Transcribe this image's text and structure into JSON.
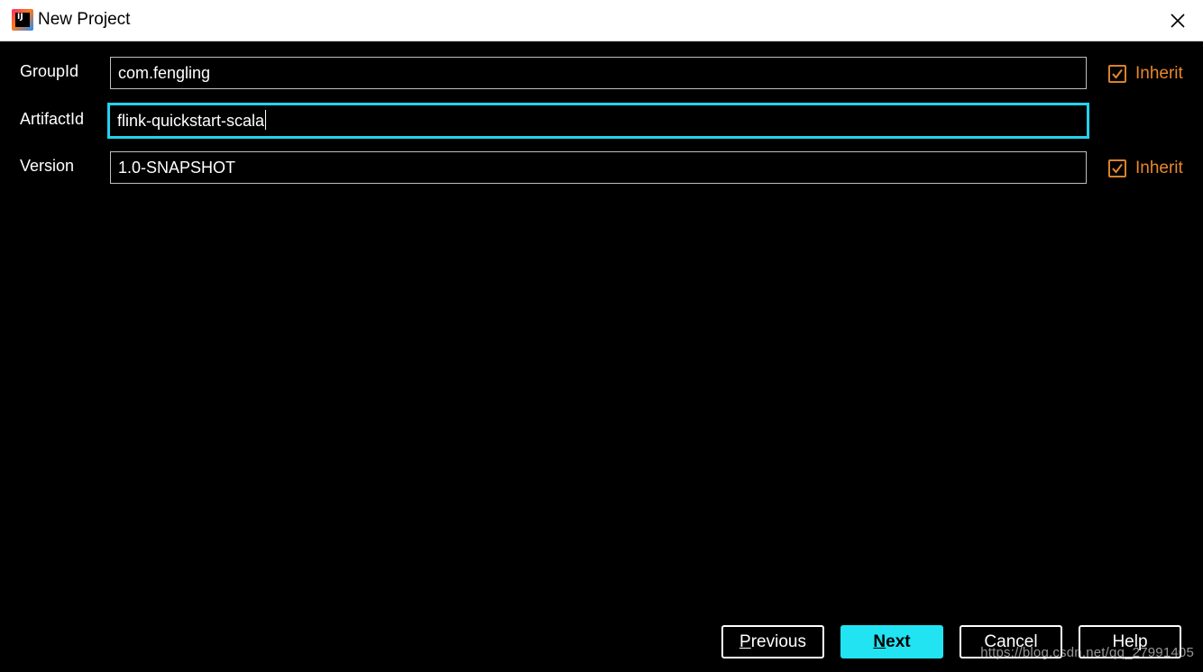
{
  "window": {
    "title": "New Project",
    "app_icon": "intellij-idea-icon",
    "close_icon": "close-icon"
  },
  "form": {
    "group_id": {
      "label": "GroupId",
      "value": "com.fengling",
      "inherit_checked": true,
      "inherit_label": "Inherit"
    },
    "artifact_id": {
      "label": "ArtifactId",
      "value": "flink-quickstart-scala",
      "focused": true
    },
    "version": {
      "label": "Version",
      "value": "1.0-SNAPSHOT",
      "inherit_checked": true,
      "inherit_label": "Inherit"
    }
  },
  "buttons": {
    "previous": {
      "mnemonic": "P",
      "rest": "revious"
    },
    "next": {
      "mnemonic": "N",
      "rest": "ext"
    },
    "cancel": {
      "label": "Cancel"
    },
    "help": {
      "label": "Help"
    }
  },
  "watermark": "https://blog.csdn.net/qq_27991405",
  "colors": {
    "background": "#000000",
    "focus_border": "#22d3ee",
    "primary_button": "#22e3f2",
    "inherit_orange": "#e8882a"
  }
}
